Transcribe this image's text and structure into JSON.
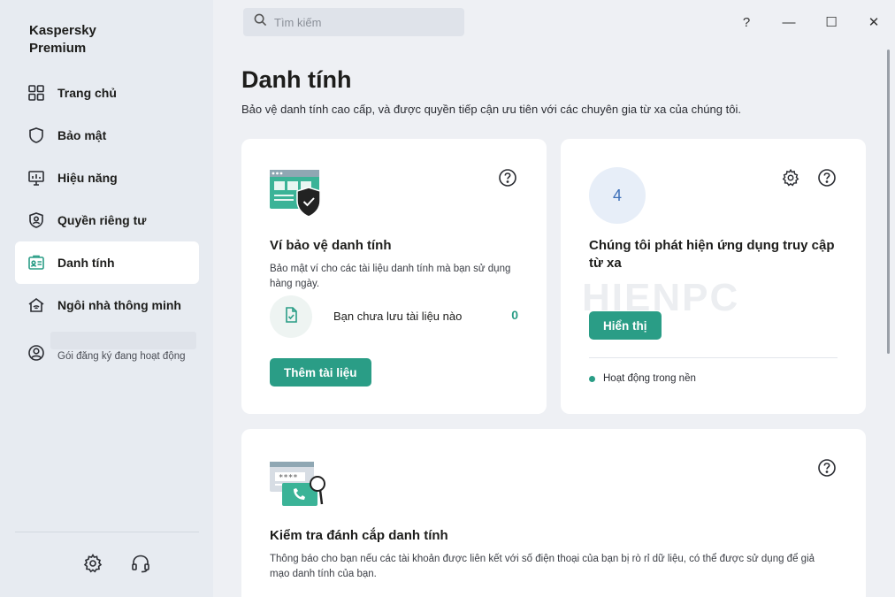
{
  "app": {
    "brand_line1": "Kaspersky",
    "brand_line2": "Premium"
  },
  "sidebar": {
    "items": [
      {
        "label": "Trang chủ",
        "icon": "home-grid-icon"
      },
      {
        "label": "Bảo mật",
        "icon": "shield-icon"
      },
      {
        "label": "Hiệu năng",
        "icon": "monitor-icon"
      },
      {
        "label": "Quyền riêng tư",
        "icon": "privacy-shield-icon"
      },
      {
        "label": "Danh tính",
        "icon": "id-card-icon",
        "active": true
      },
      {
        "label": "Ngôi nhà thông minh",
        "icon": "smart-home-icon"
      }
    ],
    "subscription_label": "Gói đăng ký đang hoạt động"
  },
  "header": {
    "search_placeholder": "Tìm kiếm",
    "help": "?",
    "minimize": "—",
    "maximize": "☐",
    "close": "✕"
  },
  "page": {
    "title": "Danh tính",
    "subtitle": "Bảo vệ danh tính cao cấp, và được quyền tiếp cận ưu tiên với các chuyên gia từ xa của chúng tôi."
  },
  "card_wallet": {
    "title": "Ví bảo vệ danh tính",
    "description": "Bảo mật ví cho các tài liệu danh tính mà bạn sử dụng hàng ngày.",
    "docs_text": "Bạn chưa lưu tài liệu nào",
    "docs_count": "0",
    "button": "Thêm tài liệu"
  },
  "card_remote": {
    "count": "4",
    "title": "Chúng tôi phát hiện ứng dụng truy cập từ xa",
    "button": "Hiển thị",
    "status": "Hoạt động trong nền"
  },
  "card_theft": {
    "title": "Kiểm tra đánh cắp danh tính",
    "description": "Thông báo cho bạn nếu các tài khoản được liên kết với số điện thoại của bạn bị rò rỉ dữ liệu, có thể được sử dụng để giả mạo danh tính của bạn."
  },
  "watermark": "HIENPC",
  "colors": {
    "accent": "#2a9d86",
    "sidebar_bg": "#e7ebf1",
    "main_bg": "#eef0f4",
    "count_blue": "#3d6fb8"
  }
}
